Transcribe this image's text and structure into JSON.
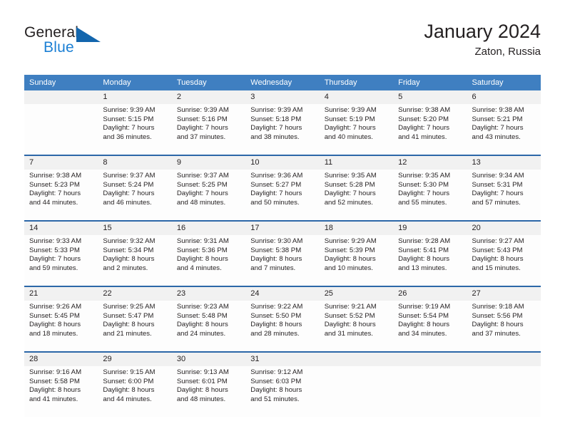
{
  "brand": {
    "name_part1": "General",
    "name_part2": "Blue",
    "mark_icon": "triangle-flag-icon"
  },
  "header": {
    "title": "January 2024",
    "location": "Zaton, Russia"
  },
  "colors": {
    "header_blue": "#3f7fc1",
    "rule_blue": "#2c67a8",
    "daynum_band": "#f1f1f1",
    "brand_blue": "#1b7fd4",
    "text": "#231f20"
  },
  "weekdays": [
    "Sunday",
    "Monday",
    "Tuesday",
    "Wednesday",
    "Thursday",
    "Friday",
    "Saturday"
  ],
  "weeks": [
    {
      "days": [
        {
          "num": "",
          "sunrise": "",
          "sunset": "",
          "daylight_1": "",
          "daylight_2": ""
        },
        {
          "num": "1",
          "sunrise": "Sunrise: 9:39 AM",
          "sunset": "Sunset: 5:15 PM",
          "daylight_1": "Daylight: 7 hours",
          "daylight_2": "and 36 minutes."
        },
        {
          "num": "2",
          "sunrise": "Sunrise: 9:39 AM",
          "sunset": "Sunset: 5:16 PM",
          "daylight_1": "Daylight: 7 hours",
          "daylight_2": "and 37 minutes."
        },
        {
          "num": "3",
          "sunrise": "Sunrise: 9:39 AM",
          "sunset": "Sunset: 5:18 PM",
          "daylight_1": "Daylight: 7 hours",
          "daylight_2": "and 38 minutes."
        },
        {
          "num": "4",
          "sunrise": "Sunrise: 9:39 AM",
          "sunset": "Sunset: 5:19 PM",
          "daylight_1": "Daylight: 7 hours",
          "daylight_2": "and 40 minutes."
        },
        {
          "num": "5",
          "sunrise": "Sunrise: 9:38 AM",
          "sunset": "Sunset: 5:20 PM",
          "daylight_1": "Daylight: 7 hours",
          "daylight_2": "and 41 minutes."
        },
        {
          "num": "6",
          "sunrise": "Sunrise: 9:38 AM",
          "sunset": "Sunset: 5:21 PM",
          "daylight_1": "Daylight: 7 hours",
          "daylight_2": "and 43 minutes."
        }
      ]
    },
    {
      "days": [
        {
          "num": "7",
          "sunrise": "Sunrise: 9:38 AM",
          "sunset": "Sunset: 5:23 PM",
          "daylight_1": "Daylight: 7 hours",
          "daylight_2": "and 44 minutes."
        },
        {
          "num": "8",
          "sunrise": "Sunrise: 9:37 AM",
          "sunset": "Sunset: 5:24 PM",
          "daylight_1": "Daylight: 7 hours",
          "daylight_2": "and 46 minutes."
        },
        {
          "num": "9",
          "sunrise": "Sunrise: 9:37 AM",
          "sunset": "Sunset: 5:25 PM",
          "daylight_1": "Daylight: 7 hours",
          "daylight_2": "and 48 minutes."
        },
        {
          "num": "10",
          "sunrise": "Sunrise: 9:36 AM",
          "sunset": "Sunset: 5:27 PM",
          "daylight_1": "Daylight: 7 hours",
          "daylight_2": "and 50 minutes."
        },
        {
          "num": "11",
          "sunrise": "Sunrise: 9:35 AM",
          "sunset": "Sunset: 5:28 PM",
          "daylight_1": "Daylight: 7 hours",
          "daylight_2": "and 52 minutes."
        },
        {
          "num": "12",
          "sunrise": "Sunrise: 9:35 AM",
          "sunset": "Sunset: 5:30 PM",
          "daylight_1": "Daylight: 7 hours",
          "daylight_2": "and 55 minutes."
        },
        {
          "num": "13",
          "sunrise": "Sunrise: 9:34 AM",
          "sunset": "Sunset: 5:31 PM",
          "daylight_1": "Daylight: 7 hours",
          "daylight_2": "and 57 minutes."
        }
      ]
    },
    {
      "days": [
        {
          "num": "14",
          "sunrise": "Sunrise: 9:33 AM",
          "sunset": "Sunset: 5:33 PM",
          "daylight_1": "Daylight: 7 hours",
          "daylight_2": "and 59 minutes."
        },
        {
          "num": "15",
          "sunrise": "Sunrise: 9:32 AM",
          "sunset": "Sunset: 5:34 PM",
          "daylight_1": "Daylight: 8 hours",
          "daylight_2": "and 2 minutes."
        },
        {
          "num": "16",
          "sunrise": "Sunrise: 9:31 AM",
          "sunset": "Sunset: 5:36 PM",
          "daylight_1": "Daylight: 8 hours",
          "daylight_2": "and 4 minutes."
        },
        {
          "num": "17",
          "sunrise": "Sunrise: 9:30 AM",
          "sunset": "Sunset: 5:38 PM",
          "daylight_1": "Daylight: 8 hours",
          "daylight_2": "and 7 minutes."
        },
        {
          "num": "18",
          "sunrise": "Sunrise: 9:29 AM",
          "sunset": "Sunset: 5:39 PM",
          "daylight_1": "Daylight: 8 hours",
          "daylight_2": "and 10 minutes."
        },
        {
          "num": "19",
          "sunrise": "Sunrise: 9:28 AM",
          "sunset": "Sunset: 5:41 PM",
          "daylight_1": "Daylight: 8 hours",
          "daylight_2": "and 13 minutes."
        },
        {
          "num": "20",
          "sunrise": "Sunrise: 9:27 AM",
          "sunset": "Sunset: 5:43 PM",
          "daylight_1": "Daylight: 8 hours",
          "daylight_2": "and 15 minutes."
        }
      ]
    },
    {
      "days": [
        {
          "num": "21",
          "sunrise": "Sunrise: 9:26 AM",
          "sunset": "Sunset: 5:45 PM",
          "daylight_1": "Daylight: 8 hours",
          "daylight_2": "and 18 minutes."
        },
        {
          "num": "22",
          "sunrise": "Sunrise: 9:25 AM",
          "sunset": "Sunset: 5:47 PM",
          "daylight_1": "Daylight: 8 hours",
          "daylight_2": "and 21 minutes."
        },
        {
          "num": "23",
          "sunrise": "Sunrise: 9:23 AM",
          "sunset": "Sunset: 5:48 PM",
          "daylight_1": "Daylight: 8 hours",
          "daylight_2": "and 24 minutes."
        },
        {
          "num": "24",
          "sunrise": "Sunrise: 9:22 AM",
          "sunset": "Sunset: 5:50 PM",
          "daylight_1": "Daylight: 8 hours",
          "daylight_2": "and 28 minutes."
        },
        {
          "num": "25",
          "sunrise": "Sunrise: 9:21 AM",
          "sunset": "Sunset: 5:52 PM",
          "daylight_1": "Daylight: 8 hours",
          "daylight_2": "and 31 minutes."
        },
        {
          "num": "26",
          "sunrise": "Sunrise: 9:19 AM",
          "sunset": "Sunset: 5:54 PM",
          "daylight_1": "Daylight: 8 hours",
          "daylight_2": "and 34 minutes."
        },
        {
          "num": "27",
          "sunrise": "Sunrise: 9:18 AM",
          "sunset": "Sunset: 5:56 PM",
          "daylight_1": "Daylight: 8 hours",
          "daylight_2": "and 37 minutes."
        }
      ]
    },
    {
      "days": [
        {
          "num": "28",
          "sunrise": "Sunrise: 9:16 AM",
          "sunset": "Sunset: 5:58 PM",
          "daylight_1": "Daylight: 8 hours",
          "daylight_2": "and 41 minutes."
        },
        {
          "num": "29",
          "sunrise": "Sunrise: 9:15 AM",
          "sunset": "Sunset: 6:00 PM",
          "daylight_1": "Daylight: 8 hours",
          "daylight_2": "and 44 minutes."
        },
        {
          "num": "30",
          "sunrise": "Sunrise: 9:13 AM",
          "sunset": "Sunset: 6:01 PM",
          "daylight_1": "Daylight: 8 hours",
          "daylight_2": "and 48 minutes."
        },
        {
          "num": "31",
          "sunrise": "Sunrise: 9:12 AM",
          "sunset": "Sunset: 6:03 PM",
          "daylight_1": "Daylight: 8 hours",
          "daylight_2": "and 51 minutes."
        },
        {
          "num": "",
          "sunrise": "",
          "sunset": "",
          "daylight_1": "",
          "daylight_2": ""
        },
        {
          "num": "",
          "sunrise": "",
          "sunset": "",
          "daylight_1": "",
          "daylight_2": ""
        },
        {
          "num": "",
          "sunrise": "",
          "sunset": "",
          "daylight_1": "",
          "daylight_2": ""
        }
      ]
    }
  ]
}
